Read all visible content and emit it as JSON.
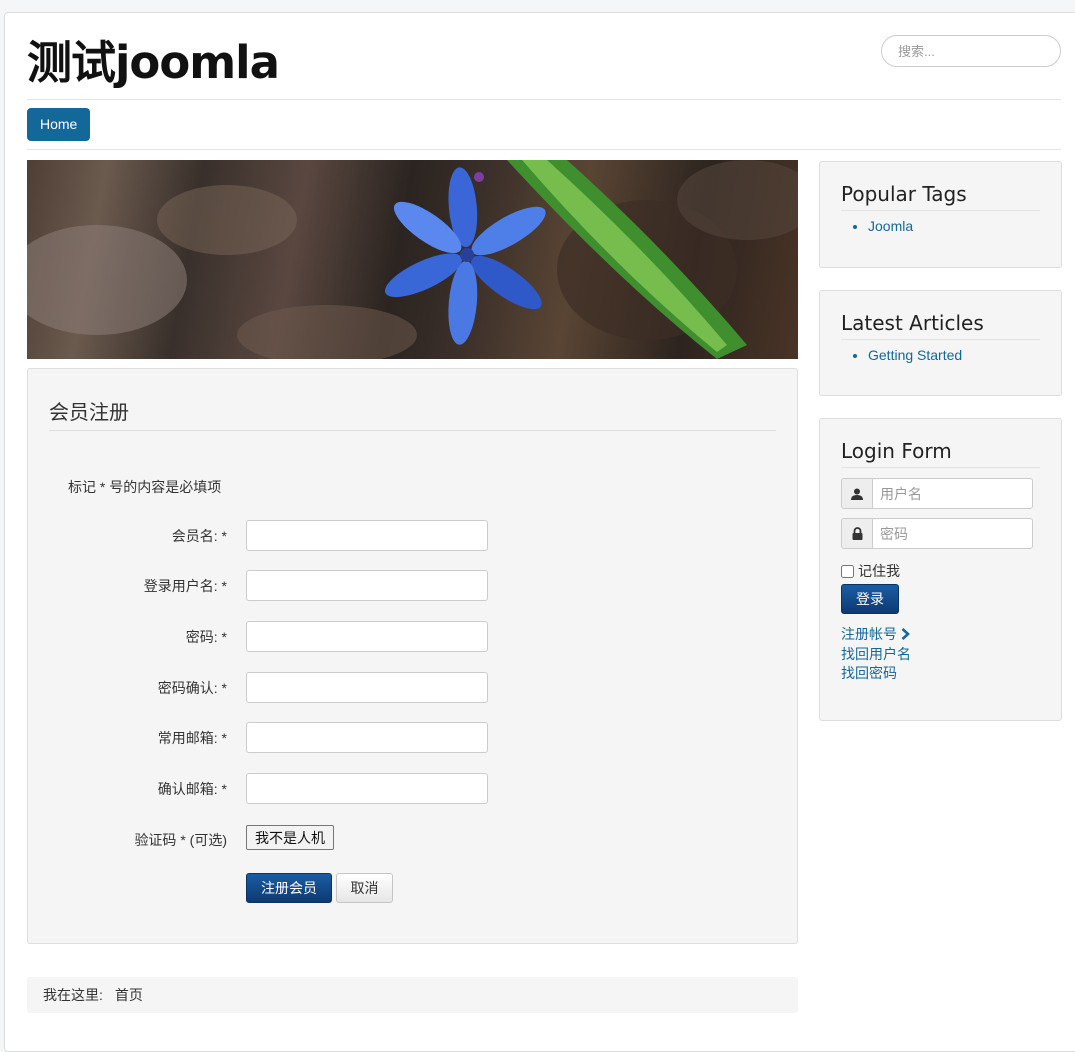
{
  "site": {
    "title": "测试joomla",
    "search_placeholder": "搜索..."
  },
  "nav": {
    "home_label": "Home"
  },
  "registration": {
    "heading": "会员注册",
    "required_note": "标记 * 号的内容是必填项",
    "fields": [
      {
        "label": "会员名: *",
        "value": ""
      },
      {
        "label": "登录用户名: *",
        "value": ""
      },
      {
        "label": "密码: *",
        "value": ""
      },
      {
        "label": "密码确认: *",
        "value": ""
      },
      {
        "label": "常用邮箱: *",
        "value": ""
      },
      {
        "label": "确认邮箱: *",
        "value": ""
      }
    ],
    "captcha_label": "验证码 * (可选)",
    "captcha_button": "我不是人机",
    "submit_label": "注册会员",
    "cancel_label": "取消"
  },
  "breadcrumb": {
    "prefix": "我在这里:",
    "home": "首页"
  },
  "sidebar": {
    "popular_tags": {
      "title": "Popular Tags",
      "items": [
        "Joomla"
      ]
    },
    "latest_articles": {
      "title": "Latest Articles",
      "items": [
        "Getting Started"
      ]
    },
    "login": {
      "title": "Login Form",
      "username_placeholder": "用户名",
      "password_placeholder": "密码",
      "remember_label": "记住我",
      "remember_checked": false,
      "login_button": "登录",
      "links": {
        "register": "注册帐号",
        "forgot_username": "找回用户名",
        "forgot_password": "找回密码"
      }
    }
  },
  "colors": {
    "link": "#146799",
    "primary": "#0c3a73",
    "well_bg": "#f5f5f5"
  },
  "icons": [
    "user-icon",
    "lock-icon",
    "chevron-right-icon"
  ]
}
